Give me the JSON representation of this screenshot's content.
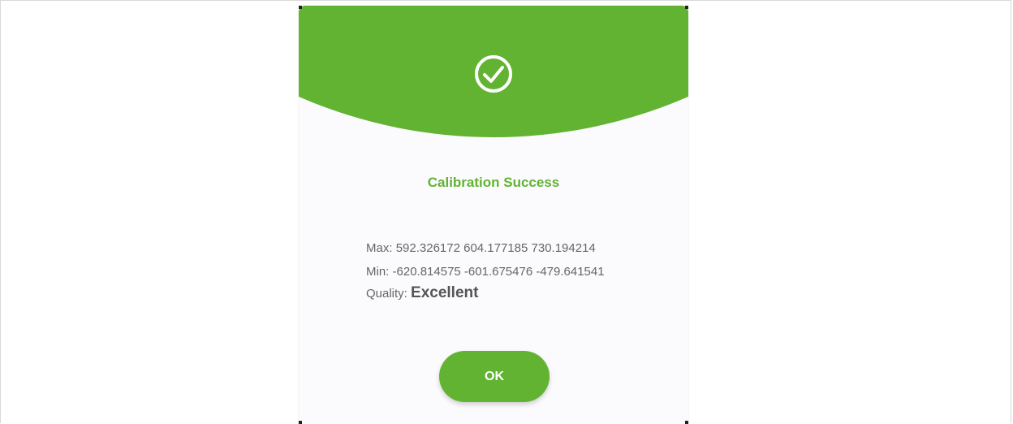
{
  "colors": {
    "accent": "#62b332",
    "background": "#fbfbfd",
    "text_muted": "#666666"
  },
  "dialog": {
    "icon": "check-circle-icon",
    "title": "Calibration Success",
    "max_label": "Max:",
    "max_values": "592.326172 604.177185 730.194214",
    "min_label": "Min:",
    "min_values": "-620.814575 -601.675476 -479.641541",
    "quality_label": "Quality:",
    "quality_value": "Excellent",
    "ok_label": "OK"
  }
}
